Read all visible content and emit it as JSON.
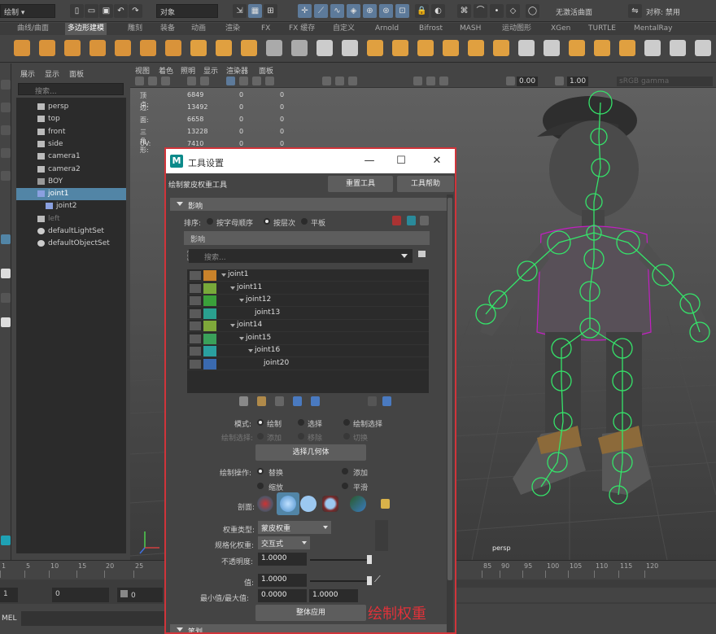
{
  "status_bar": {
    "mode_dropdown": "绘制",
    "object_dropdown": "对象",
    "live_surface": "无激活曲面",
    "symmetry": "对称: 禁用"
  },
  "shelf_tabs": [
    {
      "label": "曲线/曲面",
      "active": false
    },
    {
      "label": "多边形建模",
      "active": true
    },
    {
      "label": "雕刻",
      "active": false
    },
    {
      "label": "装备",
      "active": false
    },
    {
      "label": "动画",
      "active": false
    },
    {
      "label": "渲染",
      "active": false
    },
    {
      "label": "FX",
      "active": false
    },
    {
      "label": "FX 缓存",
      "active": false
    },
    {
      "label": "自定义",
      "active": false
    },
    {
      "label": "Arnold",
      "active": false
    },
    {
      "label": "Bifrost",
      "active": false
    },
    {
      "label": "MASH",
      "active": false
    },
    {
      "label": "运动图形",
      "active": false
    },
    {
      "label": "XGen",
      "active": false
    },
    {
      "label": "TURTLE",
      "active": false
    },
    {
      "label": "MentalRay",
      "active": false
    }
  ],
  "outliner": {
    "menu": [
      "展示",
      "显示",
      "面板"
    ],
    "search_placeholder": "搜索...",
    "items": [
      {
        "label": "persp",
        "indent": 0,
        "icon": "camera-icon",
        "selected": false,
        "dim": false
      },
      {
        "label": "top",
        "indent": 0,
        "icon": "camera-icon",
        "selected": false,
        "dim": false
      },
      {
        "label": "front",
        "indent": 0,
        "icon": "camera-icon",
        "selected": false,
        "dim": false
      },
      {
        "label": "side",
        "indent": 0,
        "icon": "camera-icon",
        "selected": false,
        "dim": false
      },
      {
        "label": "camera1",
        "indent": 0,
        "icon": "camera-icon",
        "selected": false,
        "dim": false
      },
      {
        "label": "camera2",
        "indent": 0,
        "icon": "camera-icon",
        "selected": false,
        "dim": false
      },
      {
        "label": "BOY",
        "indent": 0,
        "icon": "group-icon",
        "selected": false,
        "dim": false
      },
      {
        "label": "joint1",
        "indent": 0,
        "icon": "joint-icon",
        "selected": true,
        "dim": false
      },
      {
        "label": "joint2",
        "indent": 1,
        "icon": "joint-icon",
        "selected": false,
        "dim": false
      },
      {
        "label": "left",
        "indent": 0,
        "icon": "camera-icon",
        "selected": false,
        "dim": true
      },
      {
        "label": "defaultLightSet",
        "indent": 0,
        "icon": "set-icon",
        "selected": false,
        "dim": false
      },
      {
        "label": "defaultObjectSet",
        "indent": 0,
        "icon": "set-icon",
        "selected": false,
        "dim": false
      }
    ]
  },
  "viewport": {
    "menu": [
      "视图",
      "着色",
      "照明",
      "显示",
      "渲染器",
      "面板"
    ],
    "near_clip": "0.00",
    "far_clip": "1.00",
    "color_space": "sRGB gamma",
    "camera_label": "persp",
    "hud": [
      {
        "label": "顶点:",
        "v1": "6849",
        "v2": "0",
        "v3": "0"
      },
      {
        "label": "边:",
        "v1": "13492",
        "v2": "0",
        "v3": "0"
      },
      {
        "label": "面:",
        "v1": "6658",
        "v2": "0",
        "v3": "0"
      },
      {
        "label": "三角形:",
        "v1": "13228",
        "v2": "0",
        "v3": "0"
      },
      {
        "label": "UV:",
        "v1": "7410",
        "v2": "0",
        "v3": "0"
      }
    ]
  },
  "timeline": {
    "ticks": [
      "1",
      "5",
      "10",
      "15",
      "20",
      "25",
      "85",
      "90",
      "95",
      "100",
      "105",
      "110",
      "115",
      "120"
    ],
    "start": "1",
    "current": "0",
    "start_field": "0"
  },
  "mel": {
    "label": "MEL"
  },
  "dialog": {
    "title": "工具设置",
    "tool_name": "绘制蒙皮权重工具",
    "reset_button": "重置工具",
    "help_button": "工具帮助",
    "section_influence": "影响",
    "sort_label": "排序:",
    "sort_options": [
      {
        "label": "按字母顺序",
        "on": false
      },
      {
        "label": "按层次",
        "on": true
      },
      {
        "label": "平板",
        "on": false
      }
    ],
    "influence_bar": "影响",
    "search_placeholder": "搜索...",
    "joints": [
      {
        "name": "joint1",
        "color": "#c9822a",
        "depth": 0,
        "arrow": true
      },
      {
        "name": "joint11",
        "color": "#78a93a",
        "depth": 1,
        "arrow": true
      },
      {
        "name": "joint12",
        "color": "#3aa03a",
        "depth": 2,
        "arrow": true
      },
      {
        "name": "joint13",
        "color": "#2aa08f",
        "depth": 3,
        "arrow": false
      },
      {
        "name": "joint14",
        "color": "#7fa83a",
        "depth": 1,
        "arrow": true
      },
      {
        "name": "joint15",
        "color": "#3aa05a",
        "depth": 2,
        "arrow": true
      },
      {
        "name": "joint16",
        "color": "#2aa0a0",
        "depth": 3,
        "arrow": true
      },
      {
        "name": "joint20",
        "color": "#3a6ab0",
        "depth": 4,
        "arrow": false
      }
    ],
    "mode_label": "模式:",
    "mode_options": [
      {
        "label": "绘制",
        "on": true
      },
      {
        "label": "选择",
        "on": false
      },
      {
        "label": "绘制选择",
        "on": false
      }
    ],
    "paint_select_label": "绘制选择:",
    "paint_select_options": [
      "添加",
      "移除",
      "切换"
    ],
    "select_geometry_button": "选择几何体",
    "paint_op_label": "绘制操作:",
    "paint_ops": [
      {
        "label": "替换",
        "on": true
      },
      {
        "label": "添加",
        "on": false
      },
      {
        "label": "缩放",
        "on": false
      },
      {
        "label": "平滑",
        "on": false
      }
    ],
    "profile_label": "剖面:",
    "weight_type_label": "权重类型:",
    "weight_type_value": "蒙皮权重",
    "normalize_label": "规格化权重:",
    "normalize_value": "交互式",
    "opacity_label": "不透明度:",
    "opacity_value": "1.0000",
    "opacity_level": 1.0,
    "value_label": "值:",
    "value_value": "1.0000",
    "value_level": 1.0,
    "minmax_label": "最小值/最大值:",
    "min_value": "0.0000",
    "max_value": "1.0000",
    "flood_button": "整体应用",
    "section_stroke": "笔划"
  },
  "caption": "绘制权重"
}
